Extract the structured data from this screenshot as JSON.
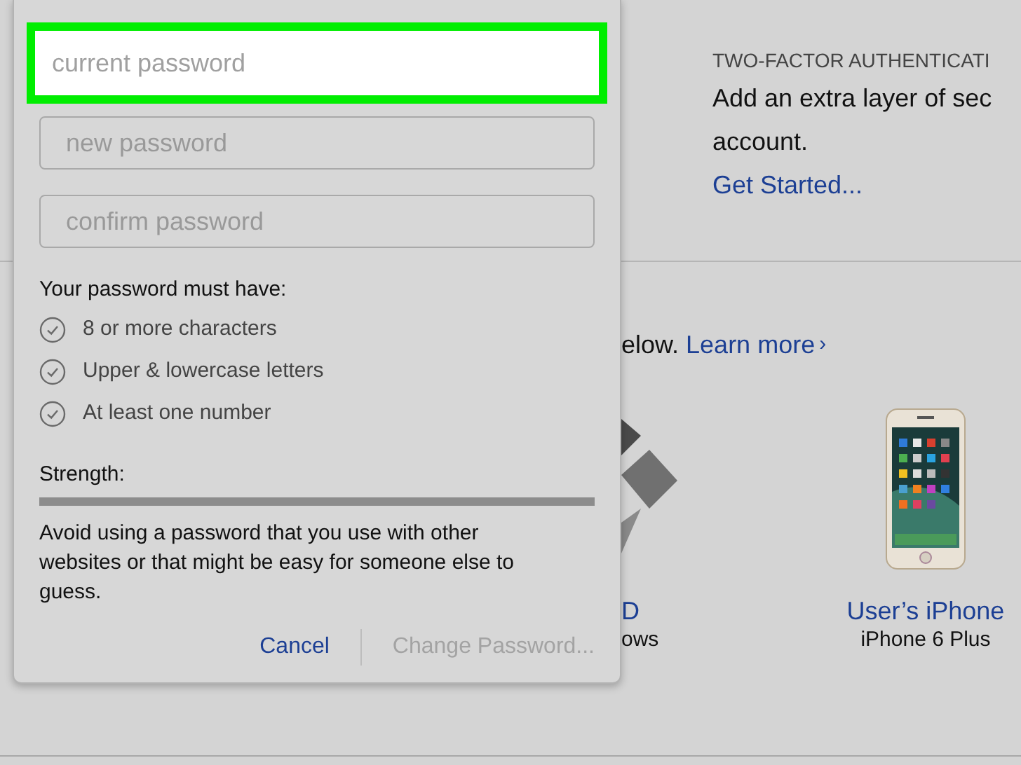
{
  "two_factor": {
    "heading": "TWO-FACTOR AUTHENTICATI",
    "text_lines": [
      "Add an extra layer of sec",
      "account."
    ],
    "link": "Get Started..."
  },
  "devices_intro": {
    "text": "elow.",
    "link": "Learn more",
    "chevron": "›"
  },
  "devices": [
    {
      "kind": "computer",
      "name": "D",
      "model": "ows"
    },
    {
      "kind": "phone",
      "name": "User’s iPhone",
      "model": "iPhone 6 Plus"
    }
  ],
  "password_popover": {
    "fields": [
      {
        "placeholder": "current password",
        "highlighted": true
      },
      {
        "placeholder": "new password",
        "highlighted": false
      },
      {
        "placeholder": "confirm password",
        "highlighted": false
      }
    ],
    "rules_heading": "Your password must have:",
    "rules": [
      {
        "text": "8 or more characters",
        "checked": false
      },
      {
        "text": "Upper & lowercase letters",
        "checked": false
      },
      {
        "text": "At least one number",
        "checked": false
      }
    ],
    "strength_label": "Strength:",
    "strength": {
      "level": 0
    },
    "advice": "Avoid using a password that you use with other websites or that might be easy for someone else to guess.",
    "buttons": [
      {
        "label": "Cancel",
        "disabled": false
      },
      {
        "label": "Change Password...",
        "disabled": true
      }
    ]
  }
}
